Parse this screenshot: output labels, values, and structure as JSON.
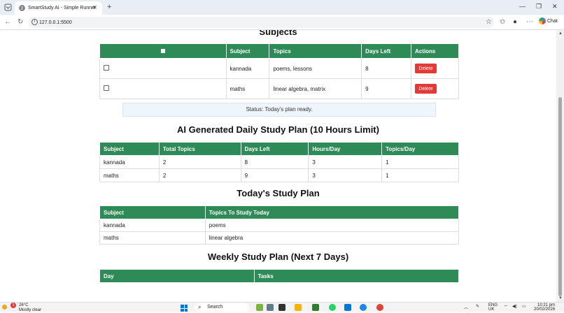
{
  "browser": {
    "tab_title": "SmartStudy AI - Simple Runner",
    "url": "127.0.0.1:5500",
    "chat_label": "Chat"
  },
  "page": {
    "subjects_heading": "Subjects",
    "subjects_table": {
      "headers": [
        "Subject",
        "Topics",
        "Days Left",
        "Actions"
      ],
      "rows": [
        {
          "subject": "kannada",
          "topics": "poems, lessons",
          "days_left": "8",
          "action": "Delete"
        },
        {
          "subject": "maths",
          "topics": "linear algebra, matrix",
          "days_left": "9",
          "action": "Delete"
        }
      ]
    },
    "status": "Status: Today's plan ready.",
    "ai_plan_heading": "AI Generated Daily Study Plan (10 Hours Limit)",
    "ai_plan_table": {
      "headers": [
        "Subject",
        "Total Topics",
        "Days Left",
        "Hours/Day",
        "Topics/Day"
      ],
      "rows": [
        [
          "kannada",
          "2",
          "8",
          "3",
          "1"
        ],
        [
          "maths",
          "2",
          "9",
          "3",
          "1"
        ]
      ]
    },
    "today_heading": "Today's Study Plan",
    "today_table": {
      "headers": [
        "Subject",
        "Topics To Study Today"
      ],
      "rows": [
        [
          "kannada",
          "poems"
        ],
        [
          "maths",
          "linear algebra"
        ]
      ]
    },
    "weekly_heading": "Weekly Study Plan (Next 7 Days)",
    "weekly_table": {
      "headers": [
        "Day",
        "Tasks"
      ]
    }
  },
  "taskbar": {
    "weather_temp": "26°C",
    "weather_desc": "Mostly clear",
    "weather_badge": "3",
    "search_placeholder": "Search",
    "lang_line1": "ENG",
    "lang_line2": "UK",
    "time": "10:21 pm",
    "date": "20/02/2026"
  },
  "colors": {
    "header_green": "#2e8b57",
    "delete_red": "#e53935",
    "status_bg": "#eef5fb"
  }
}
